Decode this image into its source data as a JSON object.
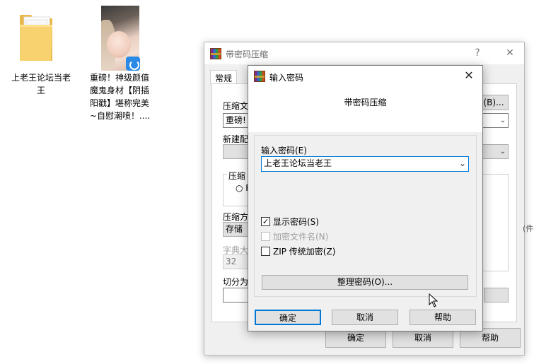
{
  "desktop": {
    "folder_label": "上老王论坛当老王",
    "file_label": "重磅！神级颜值魔鬼身材【阴插阳戳】堪称完美~自慰潮喷！...."
  },
  "back_window": {
    "title": "带密码压缩",
    "help_glyph": "?",
    "close_glyph": "✕",
    "tab_general": "常规",
    "archive_name_label": "压缩文",
    "archive_name_value": "重磅!",
    "browse_button": "(B)...",
    "update_label": "新建配",
    "options_group_label": "压缩",
    "radio_label": "R",
    "method_label": "压缩方",
    "method_value": "存储",
    "dict_label": "字典大",
    "dict_value": "32",
    "split_label": "切分为",
    "side_text": "(件",
    "ok_button": "确定",
    "cancel_button": "取消",
    "help_button": "帮助"
  },
  "dialog": {
    "title": "输入密码",
    "close_glyph": "✕",
    "header": "带密码压缩",
    "password_label": "输入密码(E)",
    "password_value": "上老王论坛当老王",
    "show_password": {
      "label": "显示密码(S)",
      "checked": true
    },
    "encrypt_names": {
      "label": "加密文件名(N)",
      "checked": false,
      "disabled": true
    },
    "zip_legacy": {
      "label": "ZIP 传统加密(Z)",
      "checked": false
    },
    "organize_button": "整理密码(O)...",
    "ok_button": "确定",
    "cancel_button": "取消",
    "help_button": "帮助"
  },
  "icons": {
    "folder": "folder-icon",
    "thumbnail": "image-thumbnail",
    "badge": "app-badge-icon",
    "rar": "winrar-icon",
    "check": "✓",
    "dropdown": "chevron-down-icon"
  },
  "colors": {
    "accent": "#0078d7",
    "dialog_bg": "#f0f0f0",
    "disabled_text": "#a0a0a0"
  }
}
